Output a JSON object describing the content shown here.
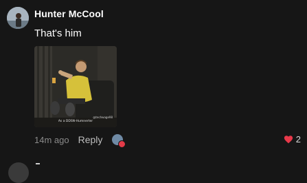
{
  "comment": {
    "author": "Hunter McCool",
    "text": "That's him",
    "gif": {
      "caption": "As a DDSN-Humnerter",
      "watermark": "@techwage98"
    },
    "timestamp": "14m ago",
    "reply_label": "Reply",
    "like_count": "2"
  },
  "colors": {
    "background": "#161616",
    "like_heart": "#e8394a",
    "muted_text": "#8a8a8a"
  },
  "icons": {
    "like": "heart-icon",
    "reply_avatar_badge": "reaction-badge-icon"
  }
}
